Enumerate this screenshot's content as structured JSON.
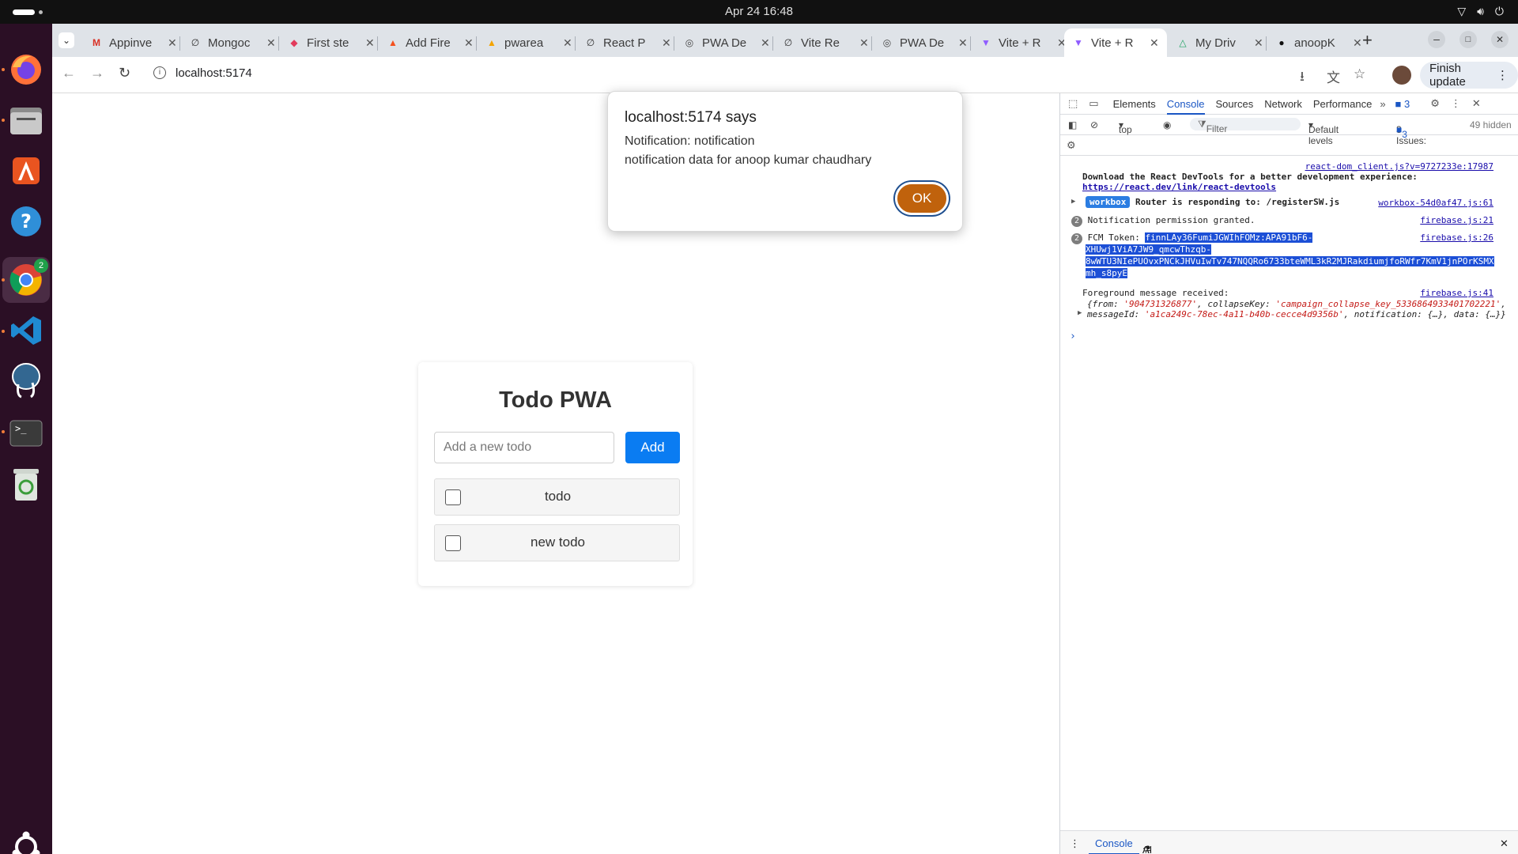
{
  "topbar": {
    "clock": "Apr 24  16:48"
  },
  "dock": {
    "items": [
      {
        "name": "firefox",
        "icon": "firefox-icon"
      },
      {
        "name": "files",
        "icon": "folder-icon"
      },
      {
        "name": "app-center",
        "icon": "app-center-icon"
      },
      {
        "name": "help",
        "icon": "help-icon"
      },
      {
        "name": "chrome",
        "icon": "chrome-icon",
        "badge": "2"
      },
      {
        "name": "vscode",
        "icon": "vscode-icon"
      },
      {
        "name": "pgadmin",
        "icon": "elephant-icon"
      },
      {
        "name": "terminal",
        "icon": "terminal-icon"
      },
      {
        "name": "trash",
        "icon": "trash-icon"
      }
    ]
  },
  "tabs": [
    {
      "label": "Appinve",
      "icon": "gmail-icon"
    },
    {
      "label": "Mongoc",
      "icon": "link-icon"
    },
    {
      "label": "First ste",
      "icon": "bird-icon"
    },
    {
      "label": "Add Fire",
      "icon": "firebase-icon"
    },
    {
      "label": "pwarea",
      "icon": "firebase-icon"
    },
    {
      "label": "React P",
      "icon": "link-icon"
    },
    {
      "label": "PWA De",
      "icon": "globe-icon"
    },
    {
      "label": "Vite Re",
      "icon": "link-icon"
    },
    {
      "label": "PWA De",
      "icon": "globe-icon"
    },
    {
      "label": "Vite + R",
      "icon": "vite-icon"
    },
    {
      "label": "Vite + R",
      "icon": "vite-icon",
      "active": true
    },
    {
      "label": "My Driv",
      "icon": "drive-icon"
    },
    {
      "label": "anoopK",
      "icon": "github-icon"
    }
  ],
  "toolbar": {
    "url": "localhost:5174",
    "finish_update": "Finish update"
  },
  "app": {
    "title": "Todo PWA",
    "input_placeholder": "Add a new todo",
    "add_label": "Add",
    "todos": [
      "todo",
      "new todo"
    ]
  },
  "dialog": {
    "title": "localhost:5174 says",
    "line1": "Notification: notification",
    "line2": "notification data for anoop kumar chaudhary",
    "ok": "OK"
  },
  "devtools": {
    "tabs": [
      "Elements",
      "Console",
      "Sources",
      "Network",
      "Performance"
    ],
    "active_tab": "Console",
    "issues_badge": "3",
    "context": "top",
    "filter_placeholder": "Filter",
    "levels": "Default levels",
    "issues": "3 Issues:",
    "issues_count": "3",
    "hidden": "49 hidden",
    "console": {
      "l1_src": "react-dom_client.js?v=9727233e:17987",
      "l1_text": "Download the React DevTools for a better development experience:",
      "l1_link": "https://react.dev/link/react-devtools",
      "l2_badge": "workbox",
      "l2_text": "Router is responding to: /registerSW.js",
      "l2_src": "workbox-54d0af47.js:61",
      "l3_count": "2",
      "l3_text": "Notification permission granted.",
      "l3_src": "firebase.js:21",
      "l4_count": "2",
      "l4_label": "FCM Token:",
      "l4_tok1": "finnLAy36FumiJGWIhFOMz:APA91bF6-",
      "l4_tok2": "XHUwj1ViA7JW9_qmcwThzqb-",
      "l4_tok3": "8wWTU3NIePUOvxPNCkJHVuIwTv747NQQRo6733bteWML3kR2MJRakdiumjfoRWfr7KmV1jnPOrKSMX",
      "l4_tok4": "mh_s8pyE",
      "l4_src": "firebase.js:26",
      "l5_text": "Foreground message received:",
      "l5_src": "firebase.js:41",
      "l5_obj1a": "{from: ",
      "l5_from": "'904731326877'",
      "l5_obj1b": ", collapseKey: ",
      "l5_ck": "'campaign_collapse_key_5336864933401702221'",
      "l5_obj2a": ", messageId: ",
      "l5_mid": "'a1ca249c-78ec-4a11-b40b-cecce4d9356b'",
      "l5_obj2b": ", notification: {…}, data: {…}}"
    },
    "bottom_console": "Console",
    "bottom_ai": "AI assistance"
  }
}
